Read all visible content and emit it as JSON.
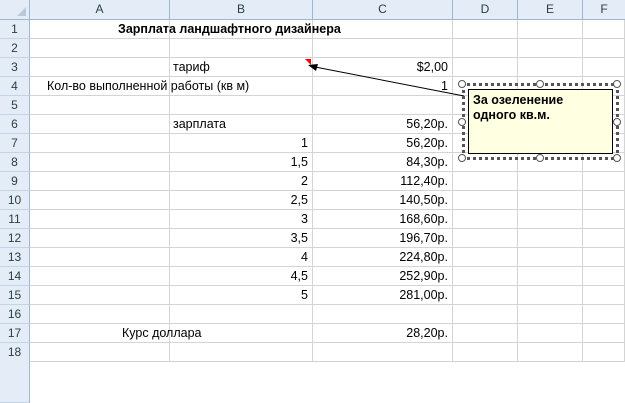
{
  "columns": [
    "A",
    "B",
    "C",
    "D",
    "E",
    "F"
  ],
  "rows": [
    "1",
    "2",
    "3",
    "4",
    "5",
    "6",
    "7",
    "8",
    "9",
    "10",
    "11",
    "12",
    "13",
    "14",
    "15",
    "16",
    "17",
    "18"
  ],
  "cells": {
    "title": "Зарплата ландшафтного дизайнера",
    "tariff_label": "тариф",
    "tariff_value": "$2,00",
    "work_label": "Кол-во выполненной работы (кв м)",
    "work_value": "1",
    "salary_label": "зарплата",
    "salary_value": "56,20р.",
    "table": [
      {
        "qty": "1",
        "pay": "56,20р."
      },
      {
        "qty": "1,5",
        "pay": "84,30р."
      },
      {
        "qty": "2",
        "pay": "112,40р."
      },
      {
        "qty": "2,5",
        "pay": "140,50р."
      },
      {
        "qty": "3",
        "pay": "168,60р."
      },
      {
        "qty": "3,5",
        "pay": "196,70р."
      },
      {
        "qty": "4",
        "pay": "224,80р."
      },
      {
        "qty": "4,5",
        "pay": "252,90р."
      },
      {
        "qty": "5",
        "pay": "281,00р."
      }
    ],
    "rate_label": "Курс доллара",
    "rate_value": "28,20р."
  },
  "comment": {
    "text": "За озеленение одного кв.м."
  },
  "colors": {
    "header_bg": "#e4ecf7",
    "comment_bg": "#ffffe1",
    "comment_indicator": "#ff0000"
  }
}
